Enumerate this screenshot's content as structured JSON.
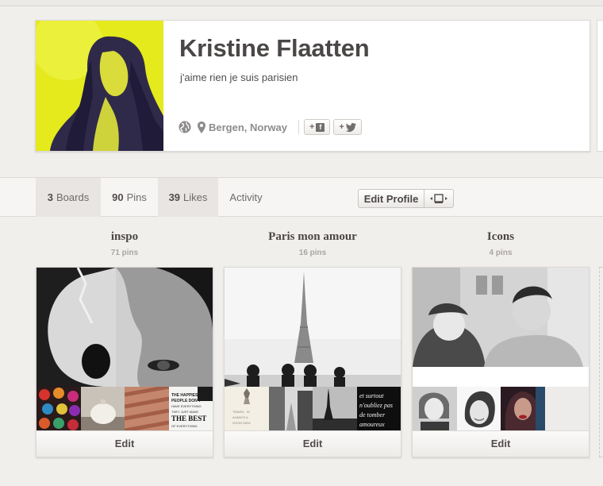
{
  "profile": {
    "name": "Kristine Flaatten",
    "bio": "j'aime rien je suis parisien",
    "location": "Bergen, Norway",
    "share_facebook_label": "+",
    "share_twitter_label": "+"
  },
  "tabs": [
    {
      "count": "3",
      "label": "Boards"
    },
    {
      "count": "90",
      "label": "Pins"
    },
    {
      "count": "39",
      "label": "Likes"
    },
    {
      "count": "",
      "label": "Activity"
    }
  ],
  "toolbar": {
    "edit_profile_label": "Edit Profile"
  },
  "boards": [
    {
      "title": "inspo",
      "count": "71 pins",
      "edit_label": "Edit"
    },
    {
      "title": "Paris mon amour",
      "count": "16 pins",
      "edit_label": "Edit"
    },
    {
      "title": "Icons",
      "count": "4 pins",
      "edit_label": "Edit"
    }
  ],
  "thumb_text": {
    "inspo_quote": [
      "THE HAPPIEST",
      "PEOPLE DON'T",
      "HAVE EVERYTHING",
      "THEY JUST MAKE",
      "THE BEST",
      "OF EVERYTHING"
    ],
    "paris_quote": [
      "et surtout",
      "n'oubliez pas",
      "de tomber",
      "amoureux"
    ],
    "paris_small": [
      "TRAVEL",
      "IS",
      "ALWAYS A",
      "GOOD IDEA"
    ]
  },
  "colors": {
    "accent_yellow": "#e6ea1e",
    "text": "#524d4d",
    "muted": "#a8a5a2"
  }
}
